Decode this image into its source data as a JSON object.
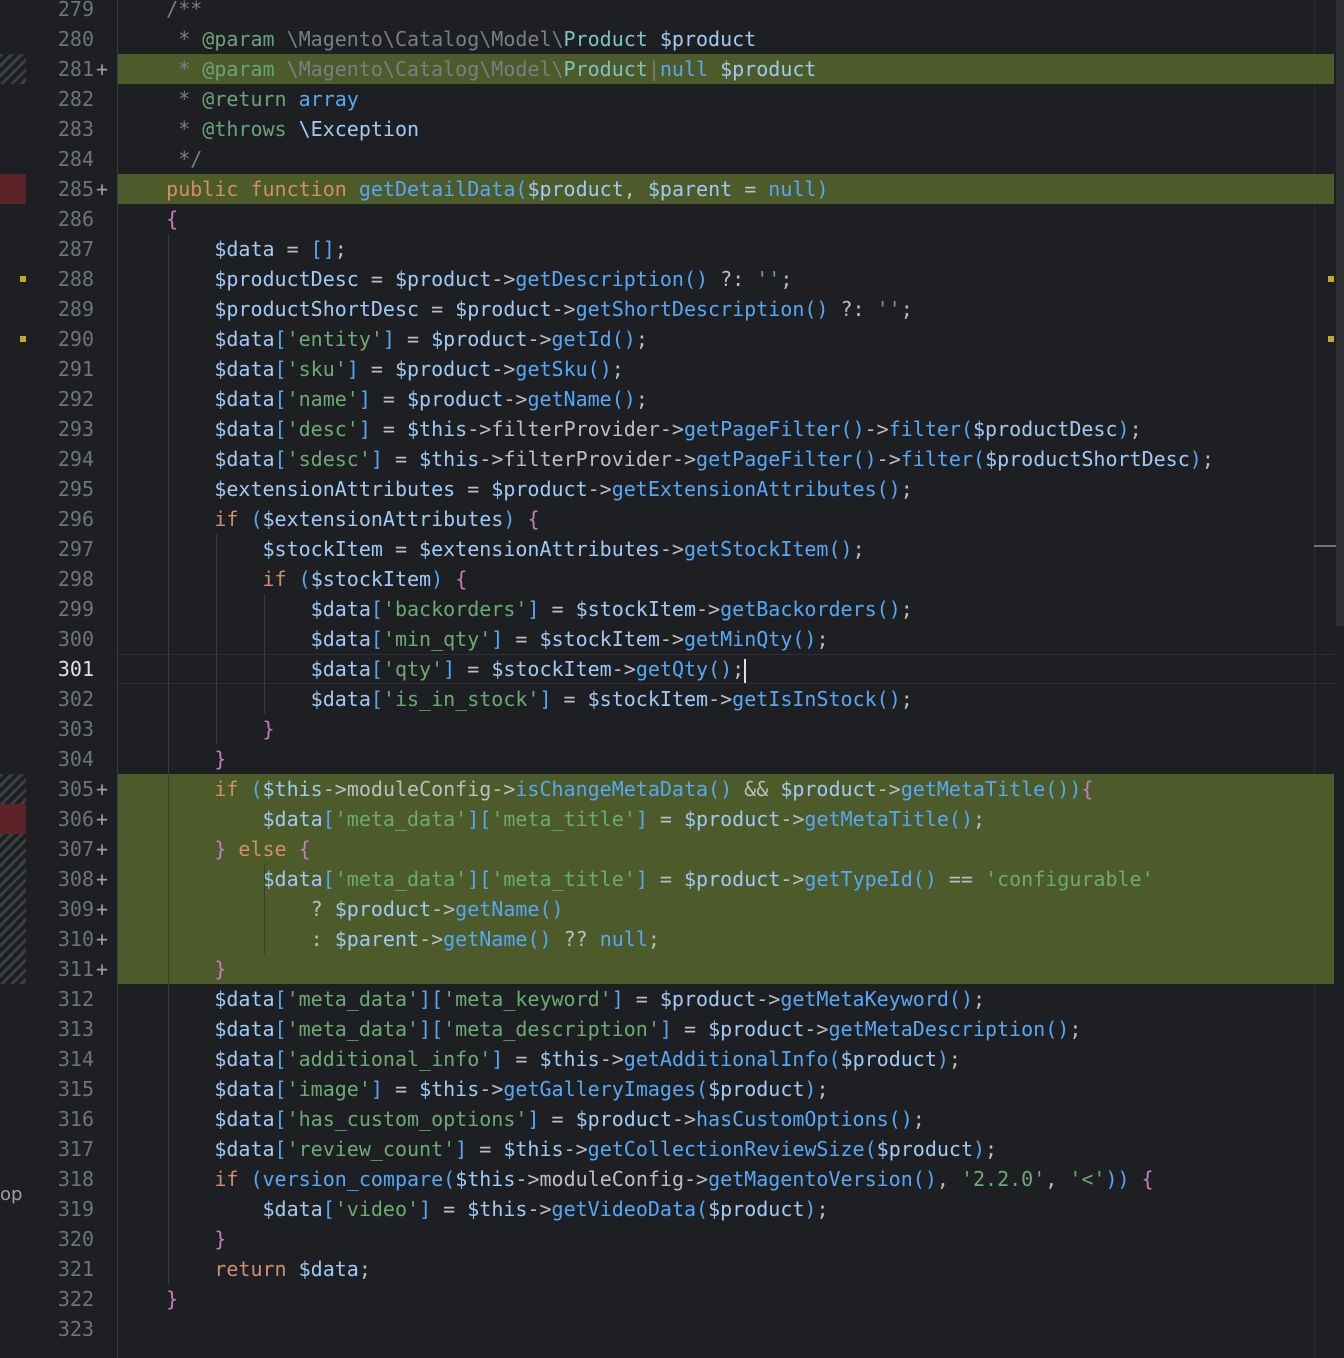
{
  "side_label": "op",
  "editor": {
    "language": "PHP",
    "caret_line": 301,
    "lines": [
      {
        "n": "279",
        "plus": "",
        "text": "    /**"
      },
      {
        "n": "280",
        "plus": "",
        "text": "     * @param \\Magento\\Catalog\\Model\\Product $product"
      },
      {
        "n": "281",
        "plus": "+",
        "text": "     * @param \\Magento\\Catalog\\Model\\Product|null $product"
      },
      {
        "n": "282",
        "plus": "",
        "text": "     * @return array"
      },
      {
        "n": "283",
        "plus": "",
        "text": "     * @throws \\Exception"
      },
      {
        "n": "284",
        "plus": "",
        "text": "     */"
      },
      {
        "n": "285",
        "plus": "+",
        "text": "    public function getDetailData($product, $parent = null)"
      },
      {
        "n": "286",
        "plus": "",
        "text": "    {"
      },
      {
        "n": "287",
        "plus": "",
        "text": "        $data = [];"
      },
      {
        "n": "288",
        "plus": "",
        "text": "        $productDesc = $product->getDescription() ?: '';"
      },
      {
        "n": "289",
        "plus": "",
        "text": "        $productShortDesc = $product->getShortDescription() ?: '';"
      },
      {
        "n": "290",
        "plus": "",
        "text": "        $data['entity'] = $product->getId();"
      },
      {
        "n": "291",
        "plus": "",
        "text": "        $data['sku'] = $product->getSku();"
      },
      {
        "n": "292",
        "plus": "",
        "text": "        $data['name'] = $product->getName();"
      },
      {
        "n": "293",
        "plus": "",
        "text": "        $data['desc'] = $this->filterProvider->getPageFilter()->filter($productDesc);"
      },
      {
        "n": "294",
        "plus": "",
        "text": "        $data['sdesc'] = $this->filterProvider->getPageFilter()->filter($productShortDesc);"
      },
      {
        "n": "295",
        "plus": "",
        "text": "        $extensionAttributes = $product->getExtensionAttributes();"
      },
      {
        "n": "296",
        "plus": "",
        "text": "        if ($extensionAttributes) {"
      },
      {
        "n": "297",
        "plus": "",
        "text": "            $stockItem = $extensionAttributes->getStockItem();"
      },
      {
        "n": "298",
        "plus": "",
        "text": "            if ($stockItem) {"
      },
      {
        "n": "299",
        "plus": "",
        "text": "                $data['backorders'] = $stockItem->getBackorders();"
      },
      {
        "n": "300",
        "plus": "",
        "text": "                $data['min_qty'] = $stockItem->getMinQty();"
      },
      {
        "n": "301",
        "plus": "",
        "text": "                $data['qty'] = $stockItem->getQty();"
      },
      {
        "n": "302",
        "plus": "",
        "text": "                $data['is_in_stock'] = $stockItem->getIsInStock();"
      },
      {
        "n": "303",
        "plus": "",
        "text": "            }"
      },
      {
        "n": "304",
        "plus": "",
        "text": "        }"
      },
      {
        "n": "305",
        "plus": "+",
        "text": "        if ($this->moduleConfig->isChangeMetaData() && $product->getMetaTitle()){"
      },
      {
        "n": "306",
        "plus": "+",
        "text": "            $data['meta_data']['meta_title'] = $product->getMetaTitle();"
      },
      {
        "n": "307",
        "plus": "+",
        "text": "        } else {"
      },
      {
        "n": "308",
        "plus": "+",
        "text": "            $data['meta_data']['meta_title'] = $product->getTypeId() == 'configurable'"
      },
      {
        "n": "309",
        "plus": "+",
        "text": "                ? $product->getName()"
      },
      {
        "n": "310",
        "plus": "+",
        "text": "                : $parent->getName() ?? null;"
      },
      {
        "n": "311",
        "plus": "+",
        "text": "        }"
      },
      {
        "n": "312",
        "plus": "",
        "text": "        $data['meta_data']['meta_keyword'] = $product->getMetaKeyword();"
      },
      {
        "n": "313",
        "plus": "",
        "text": "        $data['meta_data']['meta_description'] = $product->getMetaDescription();"
      },
      {
        "n": "314",
        "plus": "",
        "text": "        $data['additional_info'] = $this->getAdditionalInfo($product);"
      },
      {
        "n": "315",
        "plus": "",
        "text": "        $data['image'] = $this->getGalleryImages($product);"
      },
      {
        "n": "316",
        "plus": "",
        "text": "        $data['has_custom_options'] = $product->hasCustomOptions();"
      },
      {
        "n": "317",
        "plus": "",
        "text": "        $data['review_count'] = $this->getCollectionReviewSize($product);"
      },
      {
        "n": "318",
        "plus": "",
        "text": "        if (version_compare($this->moduleConfig->getMagentoVersion(), '2.2.0', '<')) {"
      },
      {
        "n": "319",
        "plus": "",
        "text": "            $data['video'] = $this->getVideoData($product);"
      },
      {
        "n": "320",
        "plus": "",
        "text": "        }"
      },
      {
        "n": "321",
        "plus": "",
        "text": "        return $data;"
      },
      {
        "n": "322",
        "plus": "",
        "text": "    }"
      },
      {
        "n": "323",
        "plus": "",
        "text": ""
      }
    ]
  },
  "colors": {
    "background": "#1e1f22",
    "added_line": "#4d5a2a",
    "line_number": "#6f737a",
    "keyword": "#cf8e6d",
    "string": "#6aab73",
    "variable": "#c77dbb",
    "method": "#56a8f5"
  }
}
